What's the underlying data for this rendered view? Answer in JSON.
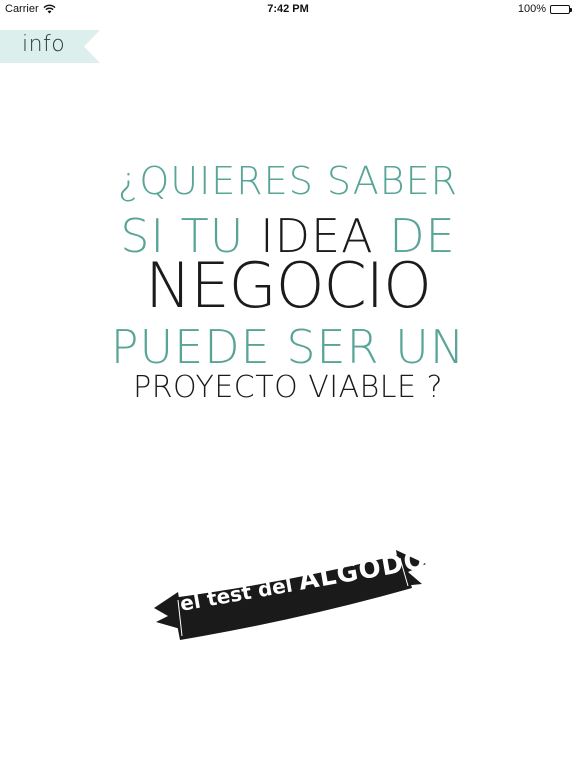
{
  "status_bar": {
    "carrier": "Carrier",
    "time": "7:42 PM",
    "battery": "100%",
    "icons": [
      "wifi-icon",
      "battery-icon"
    ]
  },
  "info_tab": {
    "label": "info",
    "color": "#dcefec"
  },
  "headline": {
    "line1": "¿Quieres saber",
    "line2_a": "si tu",
    "line2_b": "idea",
    "line2_c": "de",
    "line3": "negocio",
    "line4": "puede ser un",
    "line5": "proyecto viable ?"
  },
  "logo": {
    "prefix": "el test del",
    "brand": "ALGODON"
  },
  "colors": {
    "teal": "#58a497",
    "dark": "#1b1b1b",
    "ribbon": "#1a1a1a"
  }
}
